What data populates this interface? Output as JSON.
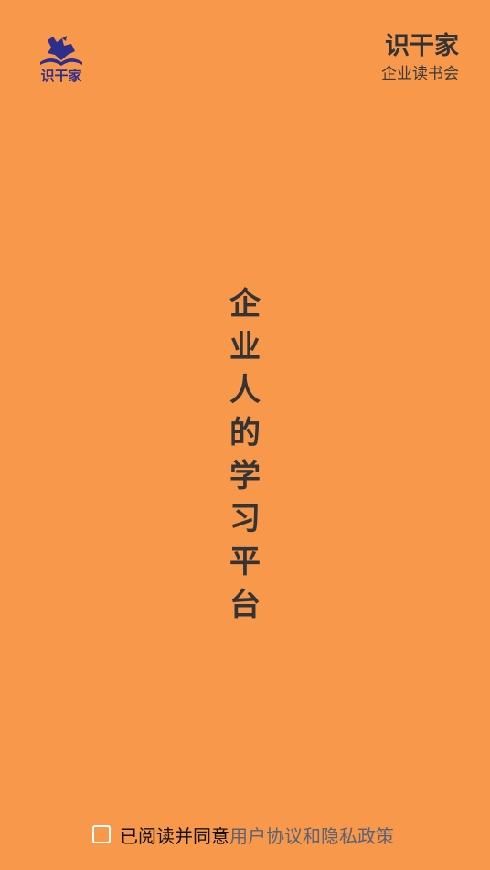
{
  "logo": {
    "icon": "horse-book-logo",
    "text": "识干家",
    "color": "#2E2F8C"
  },
  "brand": {
    "name": "识干家",
    "subtitle": "企业读书会"
  },
  "slogan": "企业人的学习平台",
  "agreement": {
    "checked": false,
    "prefix": "已阅读并同意",
    "link_text": "用户协议和隐私政策"
  },
  "colors": {
    "background": "#F7984B",
    "text": "#333333",
    "link": "#5A6275"
  }
}
